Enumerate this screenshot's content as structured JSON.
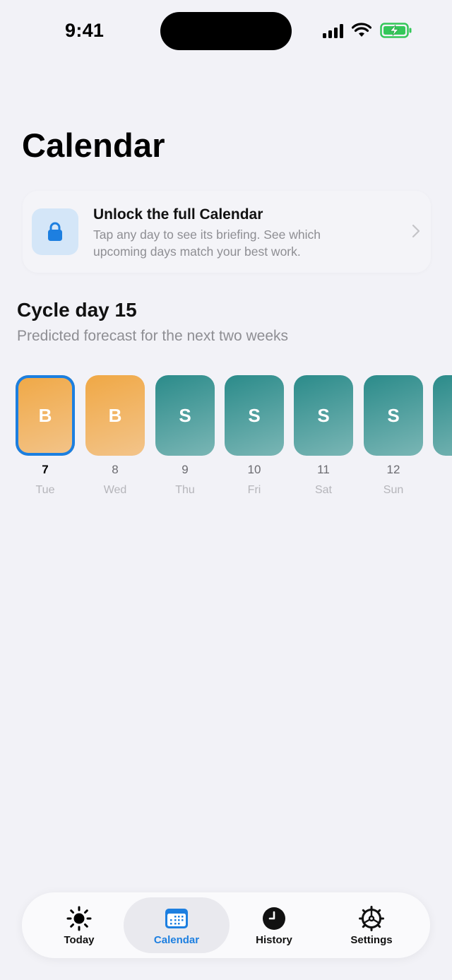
{
  "status_bar": {
    "time": "9:41"
  },
  "page": {
    "title": "Calendar"
  },
  "unlock_card": {
    "title": "Unlock the full Calendar",
    "description": "Tap any day to see its briefing. See which upcoming days match your best work.",
    "icon": "lock-icon",
    "accent": "#1d7fe0"
  },
  "cycle": {
    "title": "Cycle day 15",
    "subtitle": "Predicted forecast for the next two weeks",
    "days": [
      {
        "letter": "B",
        "number": "7",
        "weekday": "Tue",
        "kind": "B",
        "selected": true
      },
      {
        "letter": "B",
        "number": "8",
        "weekday": "Wed",
        "kind": "B",
        "selected": false
      },
      {
        "letter": "S",
        "number": "9",
        "weekday": "Thu",
        "kind": "S",
        "selected": false
      },
      {
        "letter": "S",
        "number": "10",
        "weekday": "Fri",
        "kind": "S",
        "selected": false
      },
      {
        "letter": "S",
        "number": "11",
        "weekday": "Sat",
        "kind": "S",
        "selected": false
      },
      {
        "letter": "S",
        "number": "12",
        "weekday": "Sun",
        "kind": "S",
        "selected": false
      },
      {
        "letter": "",
        "number": "",
        "weekday": "",
        "kind": "S",
        "selected": false
      }
    ],
    "colors": {
      "B": "#f0a845",
      "S": "#2b8b8a",
      "selected_border": "#1c7fe0"
    }
  },
  "tab_bar": {
    "active": "calendar",
    "tabs": [
      {
        "id": "today",
        "label": "Today",
        "icon": "sun-icon"
      },
      {
        "id": "calendar",
        "label": "Calendar",
        "icon": "calendar-icon"
      },
      {
        "id": "history",
        "label": "History",
        "icon": "clock-icon"
      },
      {
        "id": "settings",
        "label": "Settings",
        "icon": "gear-icon"
      }
    ]
  }
}
